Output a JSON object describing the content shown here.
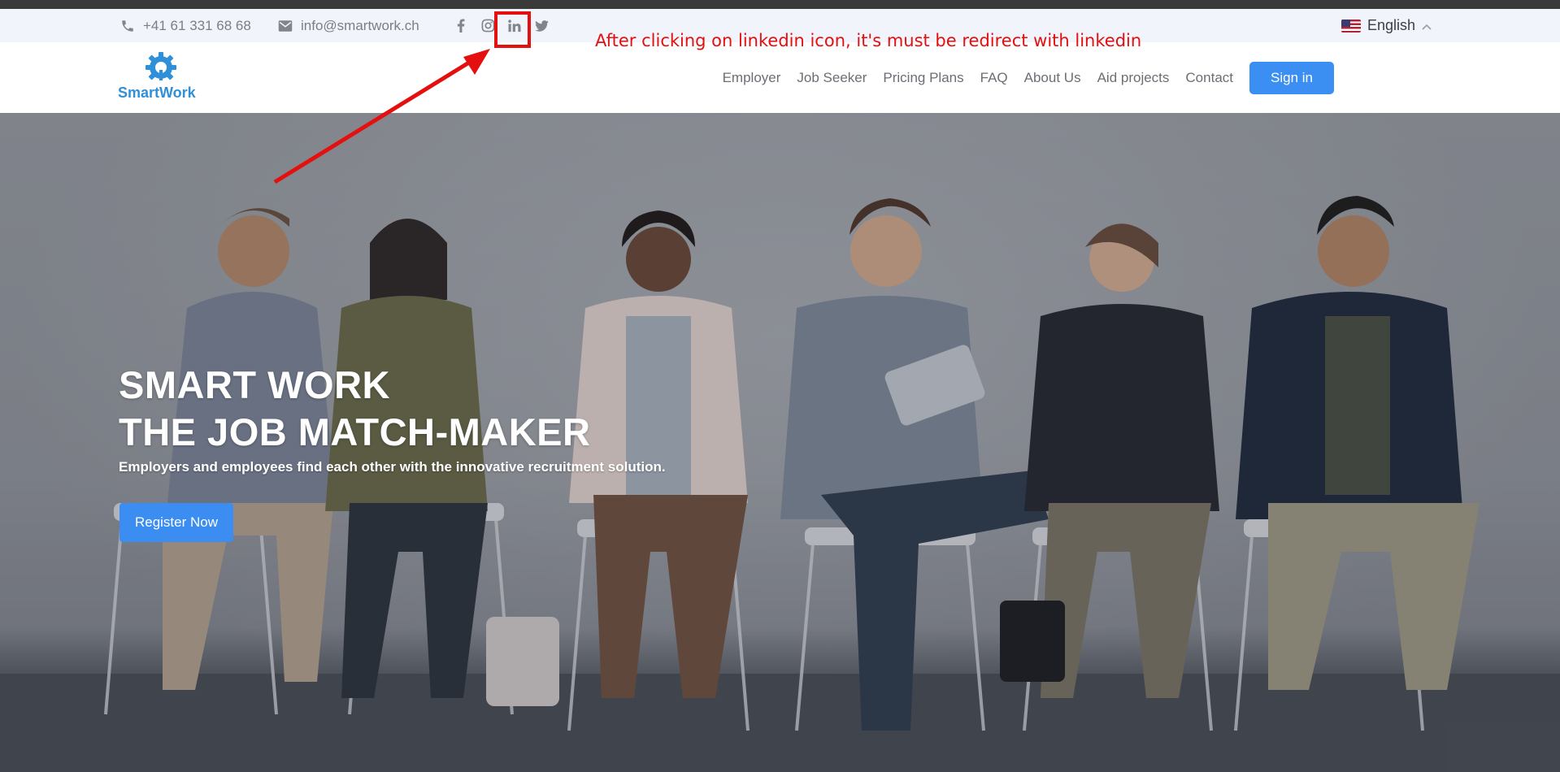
{
  "topbar": {
    "phone": "+41 61 331 68 68",
    "email": "info@smartwork.ch",
    "social_icons": [
      "facebook-icon",
      "instagram-icon",
      "linkedin-icon",
      "twitter-icon"
    ],
    "language": "English"
  },
  "navbar": {
    "logo_text": "SmartWork",
    "links": [
      "Employer",
      "Job Seeker",
      "Pricing Plans",
      "FAQ",
      "About Us",
      "Aid projects",
      "Contact"
    ],
    "signin_label": "Sign in"
  },
  "hero": {
    "title": "SMART WORK\nTHE JOB MATCH-MAKER",
    "subtitle": "Employers and employees find each other with the innovative recruitment solution.",
    "cta_label": "Register Now"
  },
  "annotation": {
    "text": "After clicking on linkedin icon, it's must be redirect with linkedin"
  },
  "colors": {
    "brand_blue": "#3b8ef2",
    "annotation_red": "#e40f0f",
    "topbar_bg": "#f1f4fa"
  }
}
